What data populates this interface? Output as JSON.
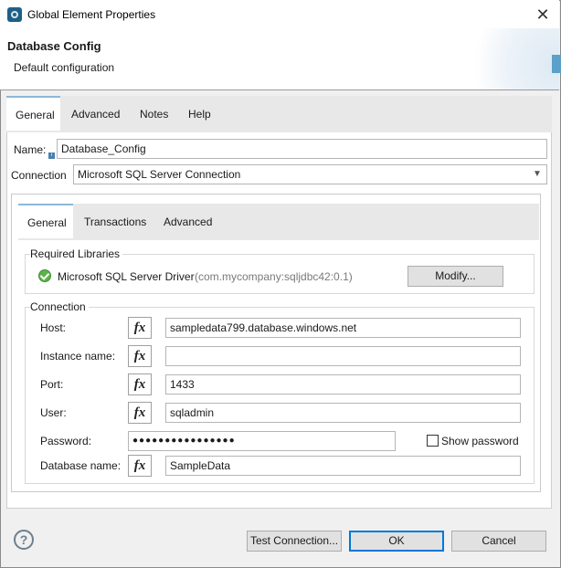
{
  "window": {
    "title": "Global Element Properties",
    "close_glyph": "✕"
  },
  "header": {
    "title": "Database Config",
    "subtitle": "Default configuration"
  },
  "outer_tabs": [
    "General",
    "Advanced",
    "Notes",
    "Help"
  ],
  "form": {
    "name_label": "Name:",
    "name_value": "Database_Config",
    "connection_label": "Connection",
    "connection_value": "Microsoft SQL Server Connection"
  },
  "inner_tabs": [
    "General",
    "Transactions",
    "Advanced"
  ],
  "required_libraries": {
    "title": "Required Libraries",
    "driver_name": "Microsoft SQL Server Driver",
    "driver_coords": "(com.mycompany:sqljdbc42:0.1)",
    "modify_label": "Modify..."
  },
  "connection": {
    "title": "Connection",
    "fx_glyph": "fx",
    "host_label": "Host:",
    "host_value": "sampledata799.database.windows.net",
    "instance_label": "Instance name:",
    "instance_value": "",
    "port_label": "Port:",
    "port_value": "1433",
    "user_label": "User:",
    "user_value": "sqladmin",
    "password_label": "Password:",
    "password_masked": "●●●●●●●●●●●●●●●●",
    "show_password_label": "Show password",
    "show_password_checked": false,
    "database_label": "Database name:",
    "database_value": "SampleData"
  },
  "footer": {
    "help_glyph": "?",
    "test_label": "Test Connection...",
    "ok_label": "OK",
    "cancel_label": "Cancel"
  },
  "colors": {
    "accent": "#0078d7",
    "tab_indicator": "#8cb7d9",
    "ok_green": "#5cb34a"
  },
  "icons": [
    "app-icon",
    "close-icon",
    "info-icon",
    "check-circle-icon",
    "fx-icon",
    "dropdown-arrow-icon",
    "help-icon"
  ]
}
